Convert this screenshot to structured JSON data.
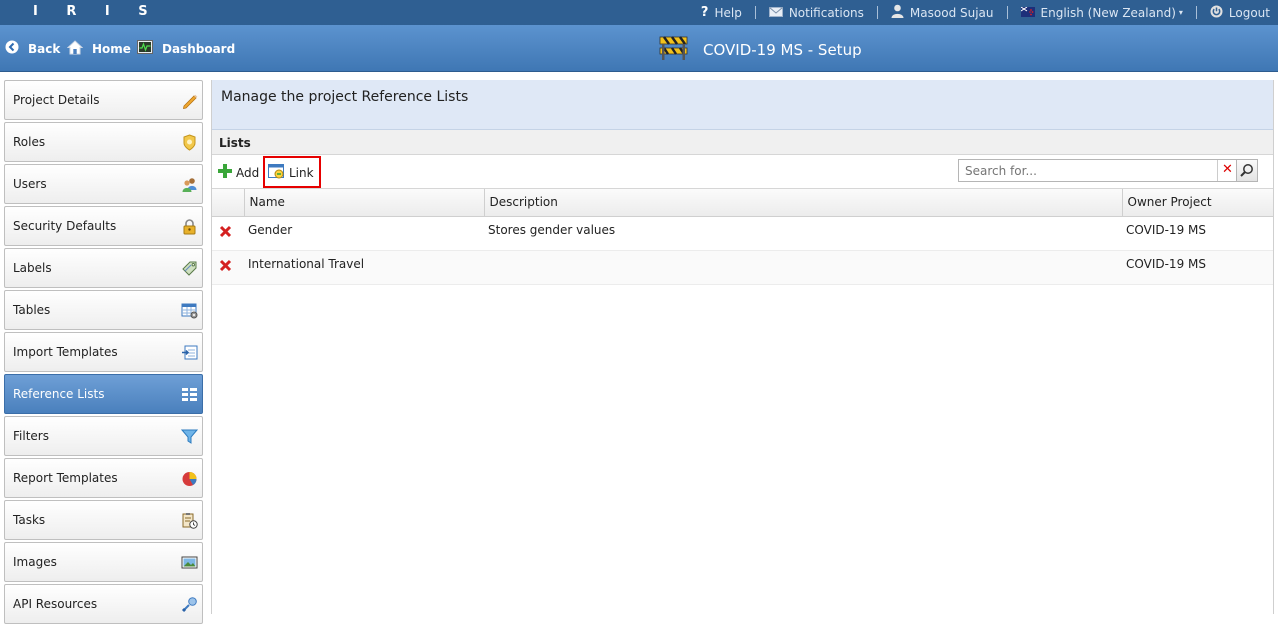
{
  "app": {
    "logo": "I R I S"
  },
  "topbar": {
    "help": "Help",
    "notifications": "Notifications",
    "user": "Masood Sujau",
    "language": "English (New Zealand)",
    "logout": "Logout"
  },
  "header": {
    "back": "Back",
    "home": "Home",
    "dashboard": "Dashboard",
    "title": "COVID-19 MS - Setup"
  },
  "sidebar": {
    "items": [
      {
        "label": "Project Details",
        "icon": "pencil-icon"
      },
      {
        "label": "Roles",
        "icon": "badge-icon"
      },
      {
        "label": "Users",
        "icon": "users-icon"
      },
      {
        "label": "Security Defaults",
        "icon": "lock-icon"
      },
      {
        "label": "Labels",
        "icon": "tags-icon"
      },
      {
        "label": "Tables",
        "icon": "table-gear-icon"
      },
      {
        "label": "Import Templates",
        "icon": "import-icon"
      },
      {
        "label": "Reference Lists",
        "icon": "list-icon",
        "active": true
      },
      {
        "label": "Filters",
        "icon": "funnel-icon"
      },
      {
        "label": "Report Templates",
        "icon": "pie-chart-icon"
      },
      {
        "label": "Tasks",
        "icon": "clipboard-clock-icon"
      },
      {
        "label": "Images",
        "icon": "image-icon"
      },
      {
        "label": "API Resources",
        "icon": "api-icon"
      }
    ]
  },
  "main": {
    "heading": "Manage the project Reference Lists",
    "panel_title": "Lists",
    "toolbar": {
      "add": "Add",
      "link": "Link"
    },
    "search": {
      "placeholder": "Search for..."
    },
    "columns": [
      "Name",
      "Description",
      "Owner Project"
    ],
    "rows": [
      {
        "name": "Gender",
        "description": "Stores gender values",
        "owner": "COVID-19 MS"
      },
      {
        "name": "International Travel",
        "description": "",
        "owner": "COVID-19 MS"
      }
    ]
  },
  "colors": {
    "topbar": "#2f5f92",
    "header": "#4a80bd",
    "active": "#4a80bd",
    "highlight": "#e60000"
  }
}
